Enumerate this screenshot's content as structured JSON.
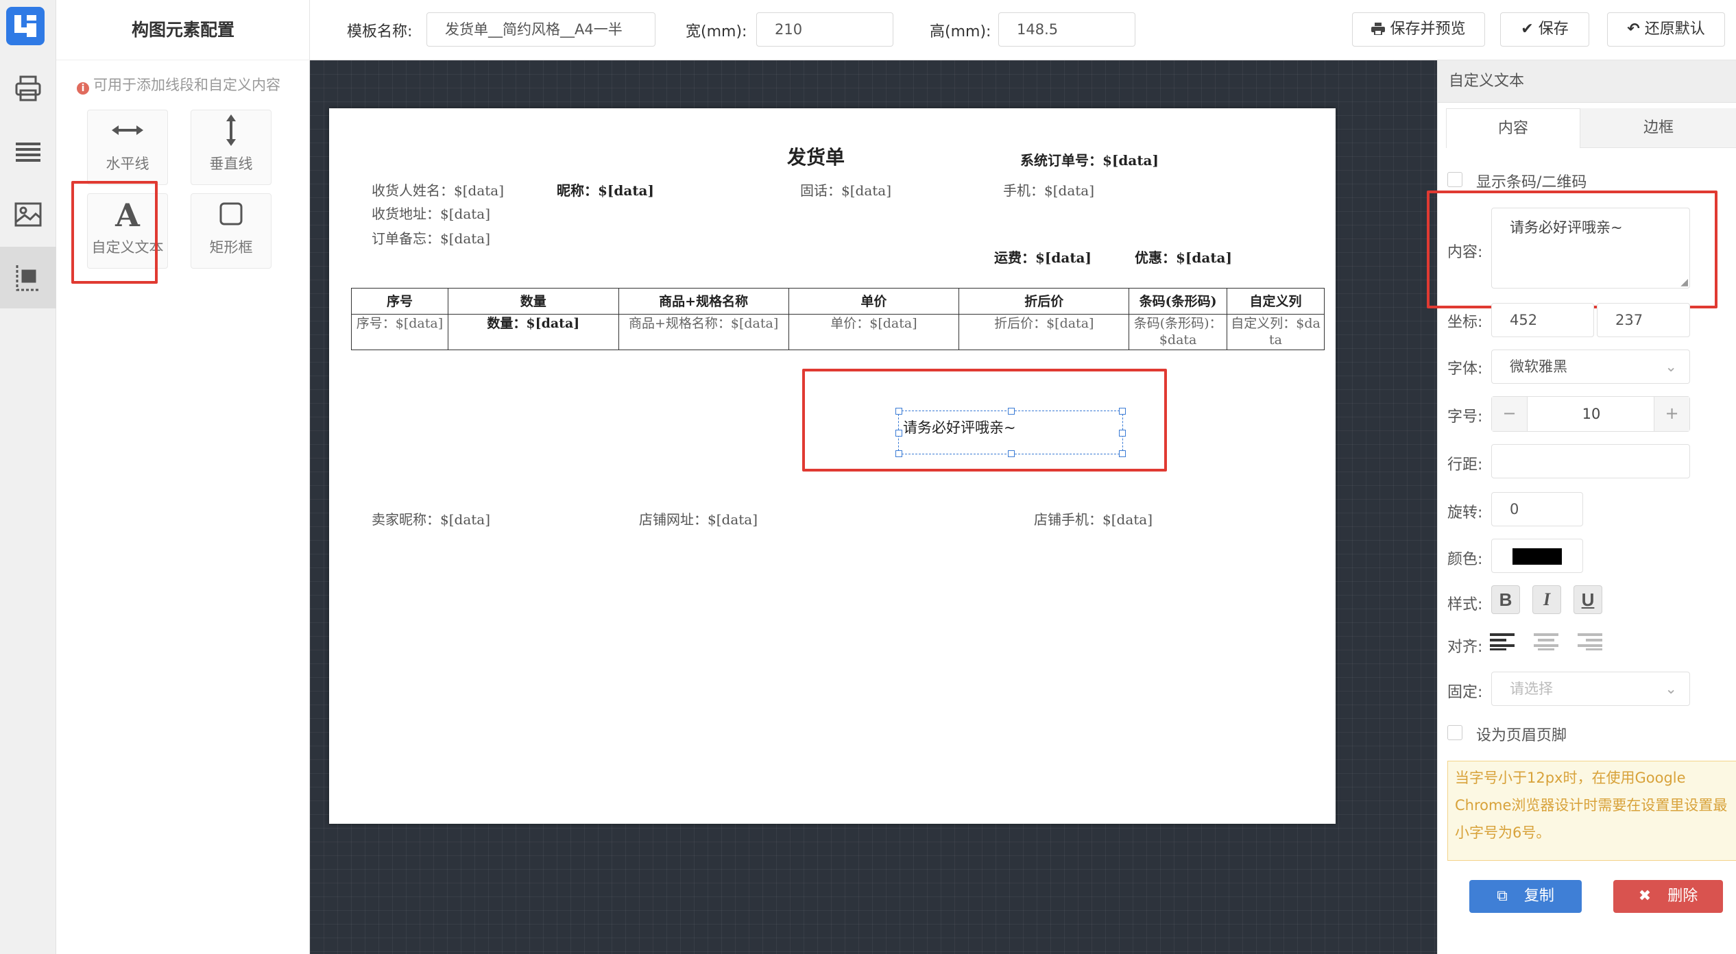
{
  "colors": {
    "accent": "#2f7ae5",
    "red_highlight": "#e03a32",
    "canvas_bg": "#2d333c",
    "copy_btn": "#3f7fd6",
    "delete_btn": "#d9534f",
    "warning_bg": "#fcf8e3",
    "warning_text": "#d8a23a"
  },
  "rail": {
    "icons": [
      "logo-icon",
      "printer-icon",
      "list-icon",
      "image-icon",
      "layout-element-icon"
    ],
    "active_index": 4
  },
  "elements_panel": {
    "title": "构图元素配置",
    "tip": "可用于添加线段和自定义内容",
    "tools": [
      {
        "label": "水平线",
        "icon": "horizontal-arrow-icon"
      },
      {
        "label": "垂直线",
        "icon": "vertical-arrow-icon"
      },
      {
        "label": "自定义文本",
        "icon": "text-a-icon"
      },
      {
        "label": "矩形框",
        "icon": "square-icon"
      }
    ]
  },
  "topbar": {
    "template_name_label": "模板名称:",
    "template_name_value": "发货单__简约风格__A4一半",
    "width_label": "宽(mm):",
    "width_value": "210",
    "height_label": "高(mm):",
    "height_value": "148.5",
    "save_preview": "保存并预览",
    "save": "保存",
    "reset": "还原默认"
  },
  "paper": {
    "title": "发货单",
    "order_no": "系统订单号：$[data]",
    "receiver_name": "收货人姓名：$[data]",
    "nickname": "昵称：$[data]",
    "phone": "固话：$[data]",
    "mobile": "手机：$[data]",
    "address": "收货地址：$[data]",
    "remark": "订单备忘：$[data]",
    "shipping": "运费：$[data]",
    "discount": "优惠：$[data]",
    "table": {
      "headers": [
        "序号",
        "数量",
        "商品+规格名称",
        "单价",
        "折后价",
        "条码(条形码)",
        "自定义列"
      ],
      "row": [
        "序号：$[data]",
        "数量：$[data]",
        "商品+规格名称：$[data]",
        "单价：$[data]",
        "折后价：$[data]",
        "条码(条形码)：$data",
        "自定义列：$data"
      ]
    },
    "custom_text": "请务必好评哦亲~",
    "seller_nick": "卖家昵称：$[data]",
    "shop_url": "店铺网址：$[data]",
    "shop_mobile": "店铺手机：$[data]"
  },
  "right_panel": {
    "header": "自定义文本",
    "tabs": [
      "内容",
      "边框"
    ],
    "active_tab": 0,
    "show_barcode_label": "显示条码/二维码",
    "content_label": "内容:",
    "content_value": "请务必好评哦亲~",
    "coord_label": "坐标:",
    "coord_x": "452",
    "coord_y": "237",
    "font_label": "字体:",
    "font_value": "微软雅黑",
    "size_label": "字号:",
    "size_value": "10",
    "size_minus": "−",
    "size_plus": "+",
    "line_height_label": "行距:",
    "rotate_label": "旋转:",
    "rotate_value": "0",
    "color_label": "颜色:",
    "color_value": "#000000",
    "style_label": "样式:",
    "style_buttons": [
      "B",
      "I",
      "U"
    ],
    "align_label": "对齐:",
    "fixed_label": "固定:",
    "fixed_placeholder": "请选择",
    "header_footer_label": "设为页眉页脚",
    "warning": "当字号小于12px时，在使用Google Chrome浏览器设计时需要在设置里设置最小字号为6号。",
    "copy": "复制",
    "delete": "删除"
  }
}
